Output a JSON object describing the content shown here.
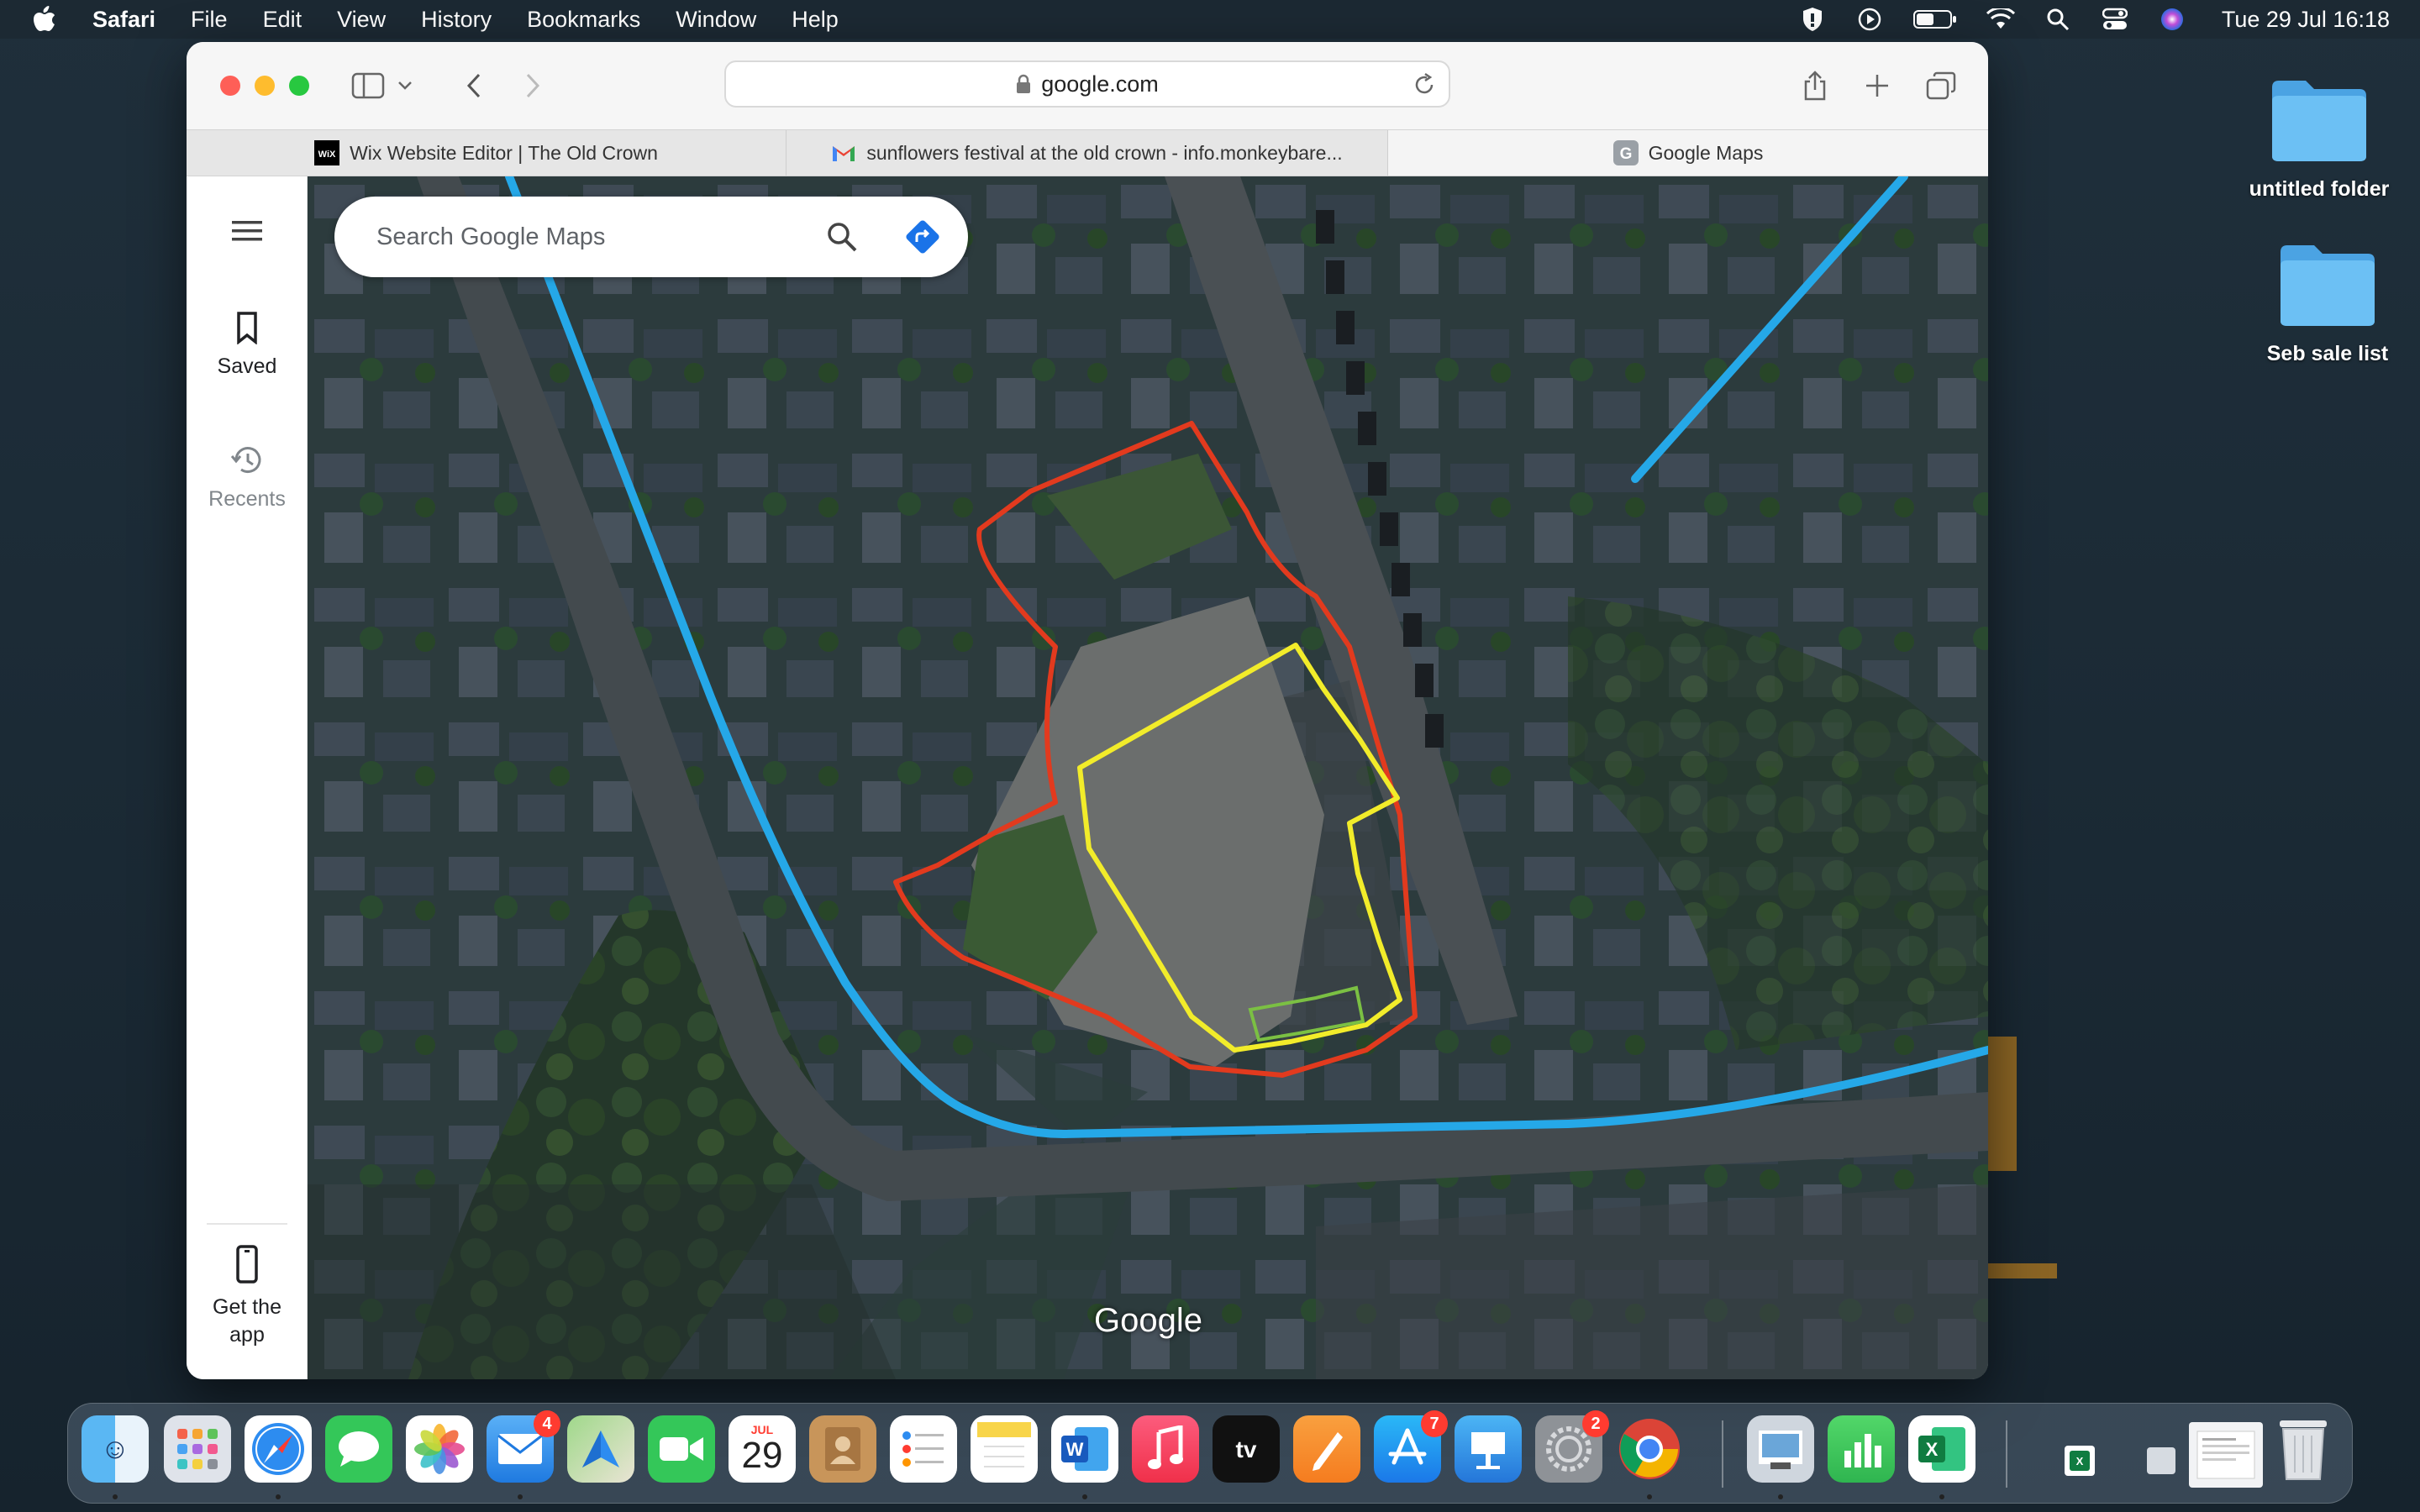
{
  "menubar": {
    "app_name": "Safari",
    "menus": [
      "File",
      "Edit",
      "View",
      "History",
      "Bookmarks",
      "Window",
      "Help"
    ],
    "clock": "Tue 29 Jul  16:18"
  },
  "browser": {
    "url": "google.com",
    "tabs": [
      {
        "label": "Wix Website Editor | The Old Crown",
        "favicon": "wix-icon"
      },
      {
        "label": "sunflowers festival at the old crown - info.monkeybare...",
        "favicon": "gmail-icon"
      },
      {
        "label": "Google Maps",
        "favicon": "google-maps-icon"
      }
    ]
  },
  "maps": {
    "search_placeholder": "Search Google Maps",
    "rail": {
      "saved": "Saved",
      "recents": "Recents",
      "get_app_line1": "Get the",
      "get_app_line2": "app"
    },
    "watermark": "Google"
  },
  "desktop": {
    "icons": [
      {
        "label": "untitled folder"
      },
      {
        "label": "Seb sale list"
      }
    ]
  },
  "dock": {
    "calendar_month": "JUL",
    "calendar_day": "29",
    "badges": {
      "mail": "4",
      "app_store": "7",
      "system_settings": "2"
    }
  },
  "colors": {
    "accent_blue": "#1a73e8",
    "route_blue": "#27a9e8",
    "outline_red": "#e23a1e",
    "outline_yellow": "#f2ec2a",
    "outline_green": "#7bc043"
  }
}
